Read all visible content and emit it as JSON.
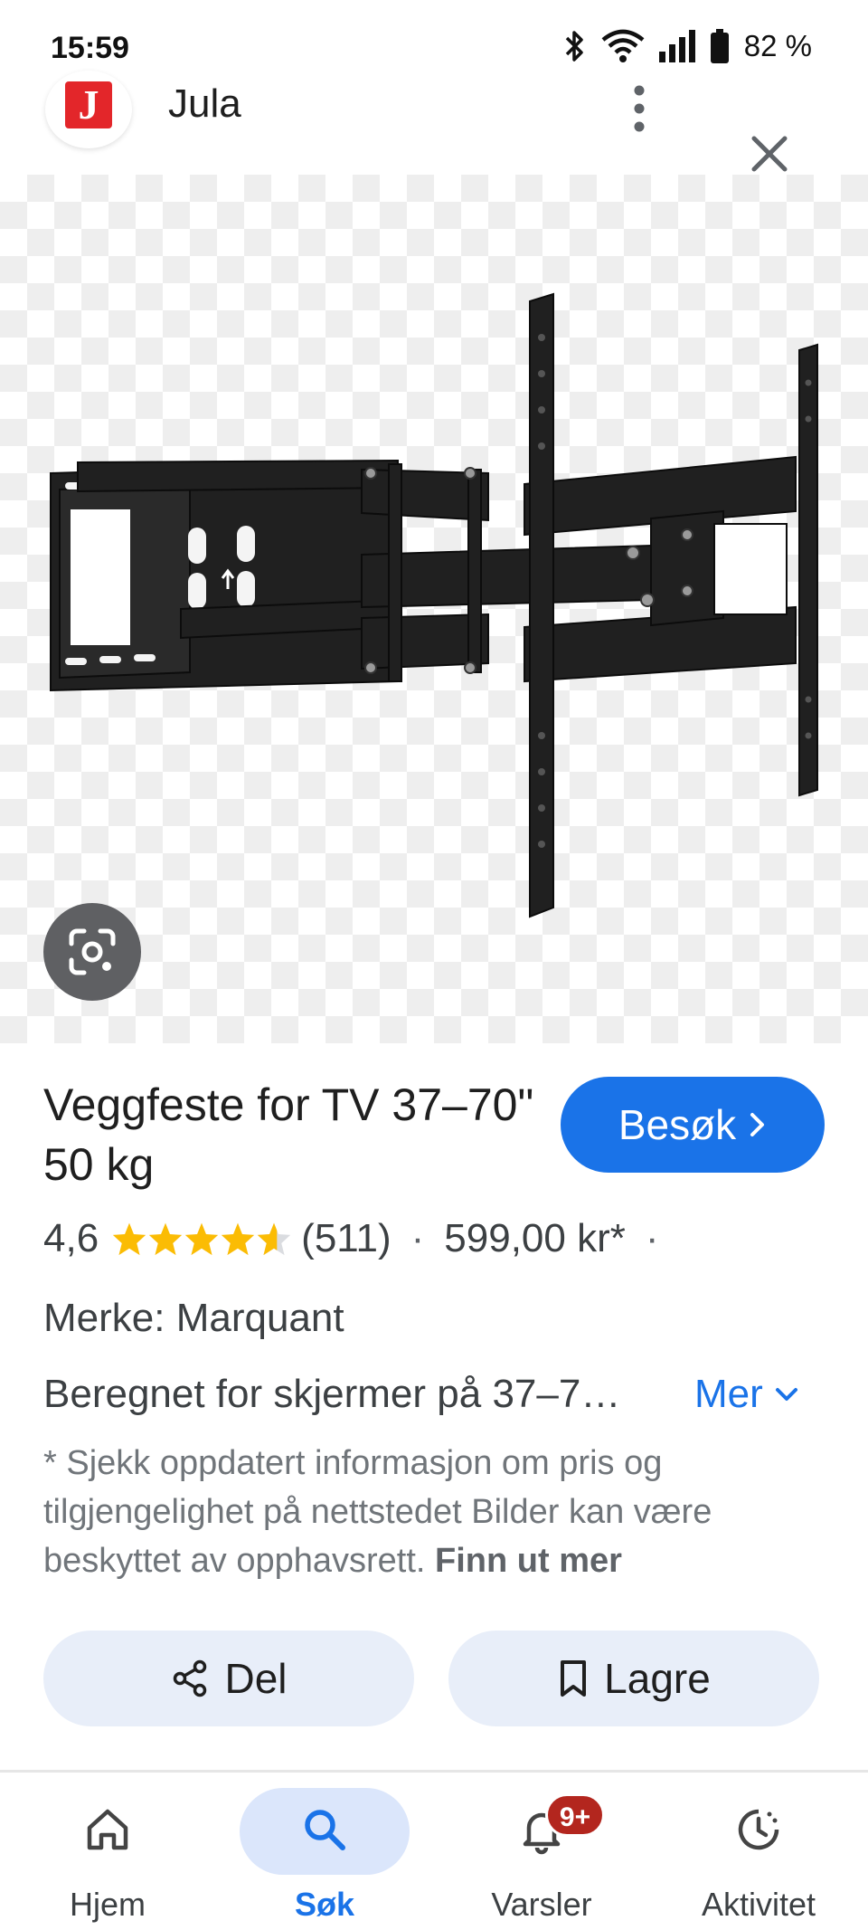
{
  "status_bar": {
    "time": "15:59",
    "battery": "82 %",
    "icons": [
      "bluetooth-icon",
      "wifi-icon",
      "signal-icon",
      "battery-icon"
    ]
  },
  "source": {
    "logo_letter": "J",
    "name": "Jula",
    "brand_color": "#e3262a"
  },
  "product": {
    "title": "Veggfeste for TV 37–70\" 50 kg",
    "visit_label": "Besøk",
    "rating": "4,6",
    "stars_value": 4.6,
    "review_count": "(511)",
    "separator": "·",
    "price": "599,00 kr*",
    "brand_line": "Merke: Marquant",
    "description": "Beregnet for skjermer på 37–7…",
    "more_label": "Mer",
    "disclaimer": "* Sjekk oppdatert informasjon om pris og tilgjengelighet på nettstedet Bilder kan være beskyttet av opphavsrett.",
    "learn_more": "Finn ut mer"
  },
  "actions": {
    "share_label": "Del",
    "save_label": "Lagre"
  },
  "bottom_nav": {
    "items": [
      {
        "label": "Hjem",
        "icon": "home-icon"
      },
      {
        "label": "Søk",
        "icon": "search-icon",
        "active": true
      },
      {
        "label": "Varsler",
        "icon": "bell-icon",
        "badge": "9+"
      },
      {
        "label": "Aktivitet",
        "icon": "activity-icon"
      }
    ]
  },
  "colors": {
    "accent": "#1a73e8",
    "star": "#fbbc04",
    "badge": "#b3261e",
    "action_bg": "#e8eef9"
  }
}
